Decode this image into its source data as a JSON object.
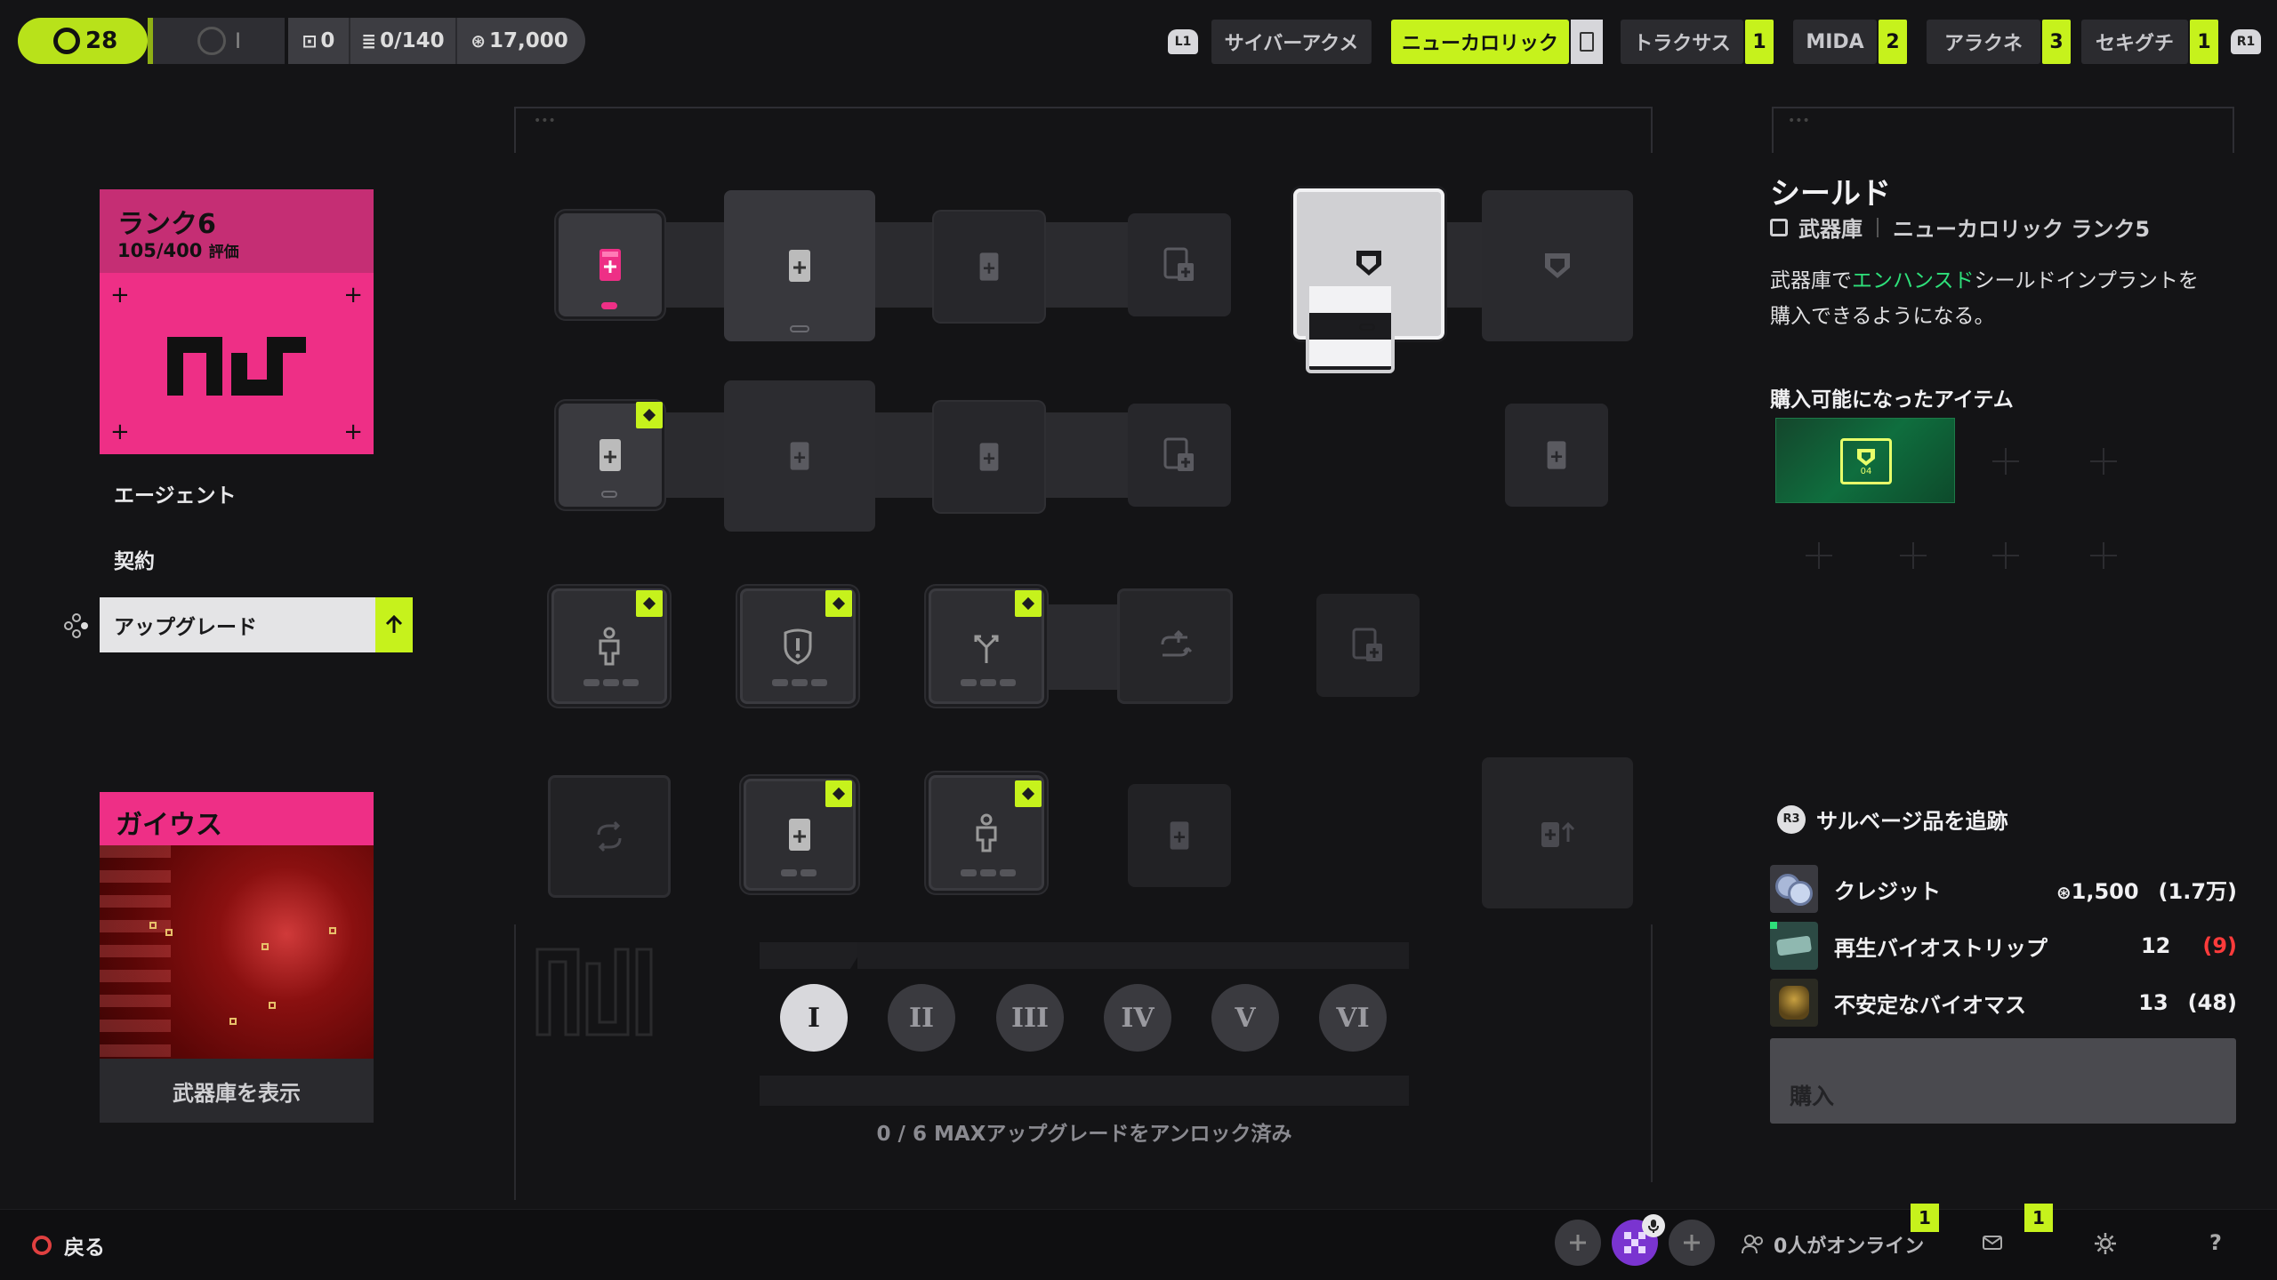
{
  "topbar": {
    "level": "28",
    "level_ring": "I",
    "storage": "0",
    "inventory": "0/140",
    "credits": "17,000",
    "shoulder_left": "L1",
    "shoulder_right": "R1",
    "factions": [
      {
        "label": "サイバーアクメ",
        "badge": ""
      },
      {
        "label": "ニューカロリック",
        "badge": ""
      },
      {
        "label": "トラクサス",
        "badge": "1"
      },
      {
        "label": "MIDA",
        "badge": "2"
      },
      {
        "label": "アラクネ",
        "badge": "3"
      },
      {
        "label": "セキグチ",
        "badge": "1"
      }
    ]
  },
  "left": {
    "rank_title": "ランク6",
    "rank_progress": "105/400",
    "rank_unit": "評価",
    "logo": "nu",
    "nav": {
      "agent": "エージェント",
      "contract": "契約",
      "upgrade": "アップグレード"
    },
    "agent_name": "ガイウス",
    "armory_label": "武器庫を表示"
  },
  "center": {
    "roman_levels": [
      "I",
      "II",
      "III",
      "IV",
      "V",
      "VI"
    ],
    "max_status": "0 / 6 MAXアップグレードをアンロック済み"
  },
  "detail": {
    "title": "シールド",
    "category": "武器庫",
    "faction_rank": "ニューカロリック ランク5",
    "desc_pre": "武器庫で",
    "desc_highlight": "エンハンスド",
    "desc_post": "シールドインプラントを",
    "desc_line2": "購入できるようになる。",
    "unlocked_heading": "購入可能になったアイテム",
    "item_code": "04"
  },
  "salvage": {
    "button": "R3",
    "title": "サルベージ品を追跡",
    "rows": [
      {
        "name": "クレジット",
        "have": "1,500",
        "need": "1.7万",
        "need_color": "#f0f0f2",
        "has_credit_icon": true
      },
      {
        "name": "再生バイオストリップ",
        "have": "12",
        "need": "9",
        "need_color": "#ff3b3b",
        "has_credit_icon": false
      },
      {
        "name": "不安定なバイオマス",
        "have": "13",
        "need": "48",
        "need_color": "#f0f0f2",
        "has_credit_icon": false
      }
    ],
    "purchase": "購入"
  },
  "bottombar": {
    "back": "戻る",
    "online": "0人がオンライン",
    "badge_online": "1",
    "badge_mail": "1",
    "help": "?"
  },
  "colors": {
    "accent": "#c6f21c",
    "pink": "#ee2f86",
    "background": "#141416",
    "alert": "#ff3b3b"
  }
}
